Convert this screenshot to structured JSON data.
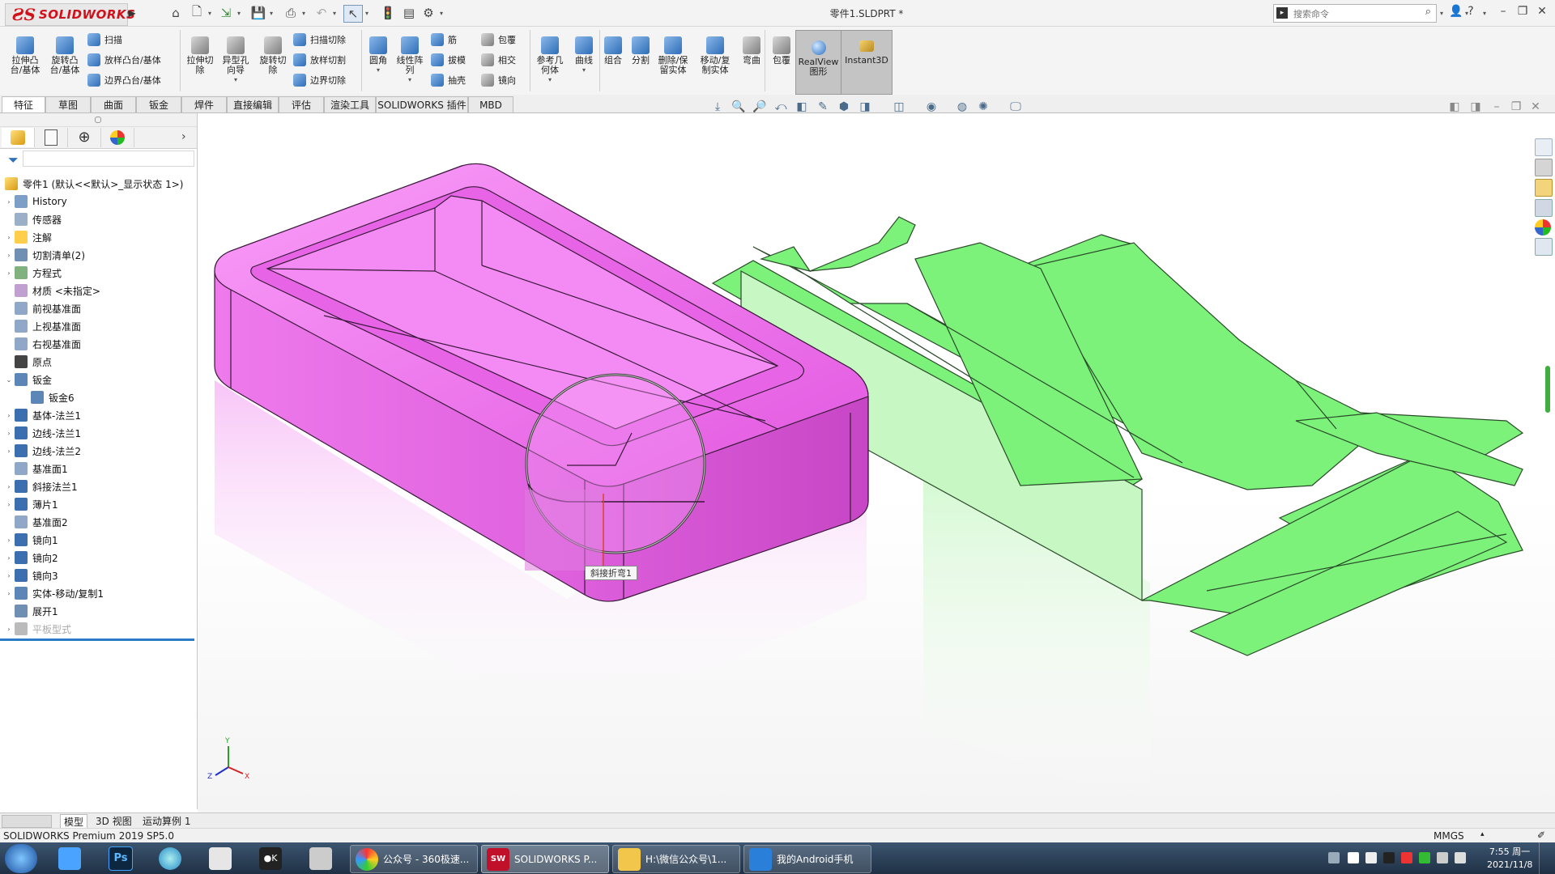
{
  "app": {
    "logo_text": "SOLIDWORKS",
    "document_title": "零件1.SLDPRT *",
    "search_placeholder": "搜索命令",
    "help_label": "?"
  },
  "ribbon": {
    "big": [
      {
        "label": "拉伸凸\n台/基体"
      },
      {
        "label": "旋转凸\n台/基体"
      },
      {
        "label": "拉伸切\n除"
      },
      {
        "label": "异型孔\n向导"
      },
      {
        "label": "旋转切\n除"
      },
      {
        "label": "圆角"
      },
      {
        "label": "线性阵\n列"
      },
      {
        "label": "参考几\n何体"
      },
      {
        "label": "曲线"
      },
      {
        "label": "组合"
      },
      {
        "label": "分割"
      },
      {
        "label": "删除/保\n留实体"
      },
      {
        "label": "移动/复\n制实体"
      },
      {
        "label": "弯曲"
      },
      {
        "label": "包覆"
      },
      {
        "label": "RealView\n图形"
      },
      {
        "label": "Instant3D"
      }
    ],
    "small": {
      "sweep": "扫描",
      "loft": "放样凸台/基体",
      "boundary": "边界凸台/基体",
      "sweep_cut": "扫描切除",
      "loft_cut": "放样切割",
      "boundary_cut": "边界切除",
      "rib": "筋",
      "draft": "拔模",
      "shell": "抽壳",
      "wrap": "包覆",
      "intersect": "相交",
      "mirror": "镜向"
    }
  },
  "tabs": [
    "特征",
    "草图",
    "曲面",
    "钣金",
    "焊件",
    "直接编辑",
    "评估",
    "渲染工具",
    "SOLIDWORKS 插件",
    "MBD"
  ],
  "tree": {
    "root": "零件1 (默认<<默认>_显示状态 1>)",
    "items": [
      {
        "label": "History",
        "exp": "›"
      },
      {
        "label": "传感器",
        "exp": ""
      },
      {
        "label": "注解",
        "exp": "›"
      },
      {
        "label": "切割清单(2)",
        "exp": "›"
      },
      {
        "label": "方程式",
        "exp": "›"
      },
      {
        "label": "材质 <未指定>",
        "exp": ""
      },
      {
        "label": "前视基准面",
        "exp": ""
      },
      {
        "label": "上视基准面",
        "exp": ""
      },
      {
        "label": "右视基准面",
        "exp": ""
      },
      {
        "label": "原点",
        "exp": ""
      },
      {
        "label": "钣金",
        "exp": "⌄"
      },
      {
        "label": "钣金6",
        "exp": ""
      },
      {
        "label": "基体-法兰1",
        "exp": "›"
      },
      {
        "label": "边线-法兰1",
        "exp": "›"
      },
      {
        "label": "边线-法兰2",
        "exp": "›"
      },
      {
        "label": "基准面1",
        "exp": ""
      },
      {
        "label": "斜接法兰1",
        "exp": "›"
      },
      {
        "label": "薄片1",
        "exp": "›"
      },
      {
        "label": "基准面2",
        "exp": ""
      },
      {
        "label": "镜向1",
        "exp": "›"
      },
      {
        "label": "镜向2",
        "exp": "›"
      },
      {
        "label": "镜向3",
        "exp": "›"
      },
      {
        "label": "实体-移动/复制1",
        "exp": "›"
      },
      {
        "label": "展开1",
        "exp": ""
      },
      {
        "label": "平板型式",
        "exp": "›"
      }
    ]
  },
  "viewport": {
    "tooltip": "斜接折弯1",
    "triad": {
      "x": "X",
      "y": "Y",
      "z": "Z"
    },
    "colors": {
      "box": "#f77bf7",
      "flat": "#7cf27a"
    }
  },
  "bottom_tabs": [
    "模型",
    "3D 视图",
    "运动算例 1"
  ],
  "status": {
    "product": "SOLIDWORKS Premium 2019 SP5.0",
    "units": "MMGS"
  },
  "taskbar": {
    "apps": [
      {
        "label": "公众号 - 360极速..."
      },
      {
        "label": "SOLIDWORKS P..."
      },
      {
        "label": "H:\\微信公众号\\1..."
      },
      {
        "label": "我的Android手机"
      }
    ],
    "time": "7:55 周一",
    "date": "2021/11/8"
  }
}
